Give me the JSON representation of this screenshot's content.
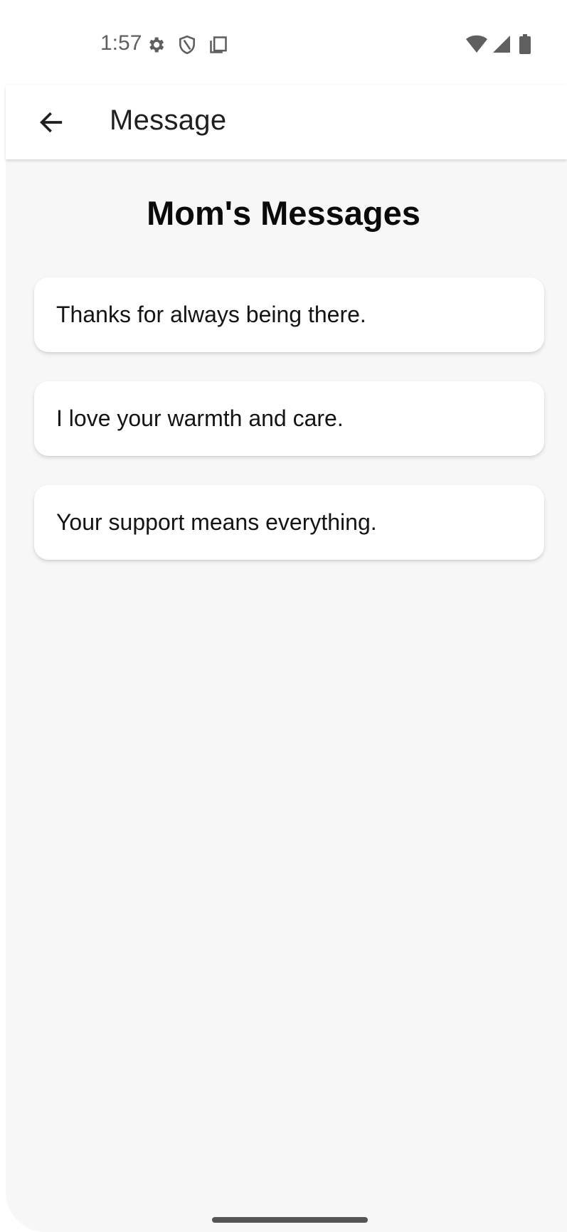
{
  "status_bar": {
    "time": "1:57",
    "left_icons": [
      "settings-gear-icon",
      "shield-icon",
      "screenshot-icon"
    ],
    "right_icons": [
      "wifi-icon",
      "cell-signal-icon",
      "battery-icon"
    ]
  },
  "app_bar": {
    "title": "Message",
    "back_icon": "arrow-left-icon"
  },
  "main": {
    "heading": "Mom's Messages",
    "messages": [
      {
        "text": "Thanks for always being there."
      },
      {
        "text": "I love your warmth and care."
      },
      {
        "text": "Your support means everything."
      }
    ]
  },
  "colors": {
    "app_bar_background": "#ffffff",
    "content_background": "#f7f7f7",
    "card_background": "#ffffff",
    "text": "#141414"
  }
}
